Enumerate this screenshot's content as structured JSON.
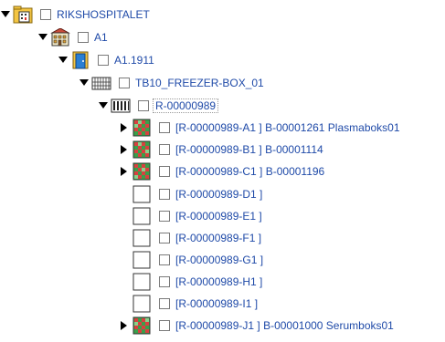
{
  "tree": {
    "root": {
      "label": "RIKSHOSPITALET",
      "icon": "building-folder-icon",
      "expanded": true
    },
    "level1": {
      "label": "A1",
      "icon": "building-icon",
      "expanded": true
    },
    "level2": {
      "label": "A1.1911",
      "icon": "room-door-icon",
      "expanded": true
    },
    "level3": {
      "label": "TB10_FREEZER-BOX_01",
      "icon": "freezer-icon",
      "expanded": true
    },
    "level4": {
      "label": "R-00000989",
      "icon": "rack-icon",
      "expanded": true
    },
    "slots": [
      {
        "id": "[R-00000989-A1 ]",
        "content": "B-00001261 Plasmaboks01",
        "icon": "sample-box-filled-icon",
        "expandable": true
      },
      {
        "id": "[R-00000989-B1 ]",
        "content": "B-00001114",
        "icon": "sample-box-filled-icon",
        "expandable": true
      },
      {
        "id": "[R-00000989-C1 ]",
        "content": "B-00001196",
        "icon": "sample-box-filled-icon",
        "expandable": true
      },
      {
        "id": "[R-00000989-D1 ]",
        "content": "",
        "icon": "empty-slot-icon",
        "expandable": false
      },
      {
        "id": "[R-00000989-E1 ]",
        "content": "",
        "icon": "empty-slot-icon",
        "expandable": false
      },
      {
        "id": "[R-00000989-F1 ]",
        "content": "",
        "icon": "empty-slot-icon",
        "expandable": false
      },
      {
        "id": "[R-00000989-G1 ]",
        "content": "",
        "icon": "empty-slot-icon",
        "expandable": false
      },
      {
        "id": "[R-00000989-H1 ]",
        "content": "",
        "icon": "empty-slot-icon",
        "expandable": false
      },
      {
        "id": "[R-00000989-I1 ]",
        "content": "",
        "icon": "empty-slot-icon",
        "expandable": false
      },
      {
        "id": "[R-00000989-J1 ]",
        "content": "B-00001000 Serumboks01",
        "icon": "sample-box-filled-icon",
        "expandable": true
      }
    ]
  },
  "colors": {
    "link": "#1f4aa8",
    "checkbox_border": "#7a7a7a"
  }
}
